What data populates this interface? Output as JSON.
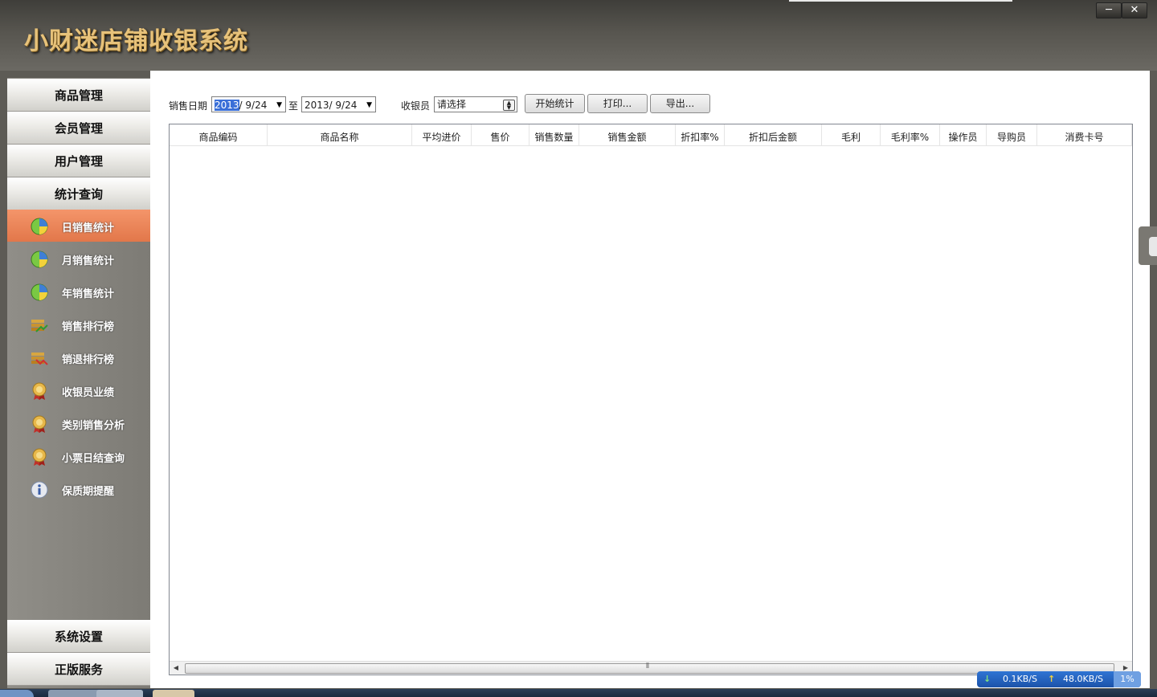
{
  "app": {
    "title": "小财迷店铺收银系统"
  },
  "window": {
    "min": "─",
    "close": "✕"
  },
  "sidebar": {
    "categories_top": [
      "商品管理",
      "会员管理",
      "用户管理",
      "统计查询"
    ],
    "items": [
      {
        "label": "日销售统计",
        "icon": "pie-chart-icon",
        "active": true
      },
      {
        "label": "月销售统计",
        "icon": "pie-chart-icon"
      },
      {
        "label": "年销售统计",
        "icon": "pie-chart-icon"
      },
      {
        "label": "销售排行榜",
        "icon": "ranking-up-icon"
      },
      {
        "label": "销退排行榜",
        "icon": "ranking-down-icon"
      },
      {
        "label": "收银员业绩",
        "icon": "medal-icon"
      },
      {
        "label": "类别销售分析",
        "icon": "medal-icon"
      },
      {
        "label": "小票日结查询",
        "icon": "medal-icon"
      },
      {
        "label": "保质期提醒",
        "icon": "info-icon"
      }
    ],
    "categories_bottom": [
      "系统设置",
      "正版服务"
    ]
  },
  "filter": {
    "date_label": "销售日期",
    "date_from_year": "2013",
    "date_from_rest": "/  9/24",
    "to_label": "至",
    "date_to": "2013/  9/24",
    "cashier_label": "收银员",
    "cashier_value": "请选择",
    "btn_start": "开始统计",
    "btn_print": "打印...",
    "btn_export": "导出..."
  },
  "table": {
    "columns": [
      "商品编码",
      "商品名称",
      "平均进价",
      "售价",
      "销售数量",
      "销售金额",
      "折扣率%",
      "折扣后金额",
      "毛利",
      "毛利率%",
      "操作员",
      "导购员",
      "消费卡号"
    ],
    "rows": []
  },
  "scroll": {
    "grip": "⦀"
  },
  "network": {
    "down": "0.1KB/S",
    "up": "48.0KB/S",
    "cpu": "1%"
  },
  "colors": {
    "active_item": "#ee8a5c",
    "title_gold": "#e7c27a"
  }
}
